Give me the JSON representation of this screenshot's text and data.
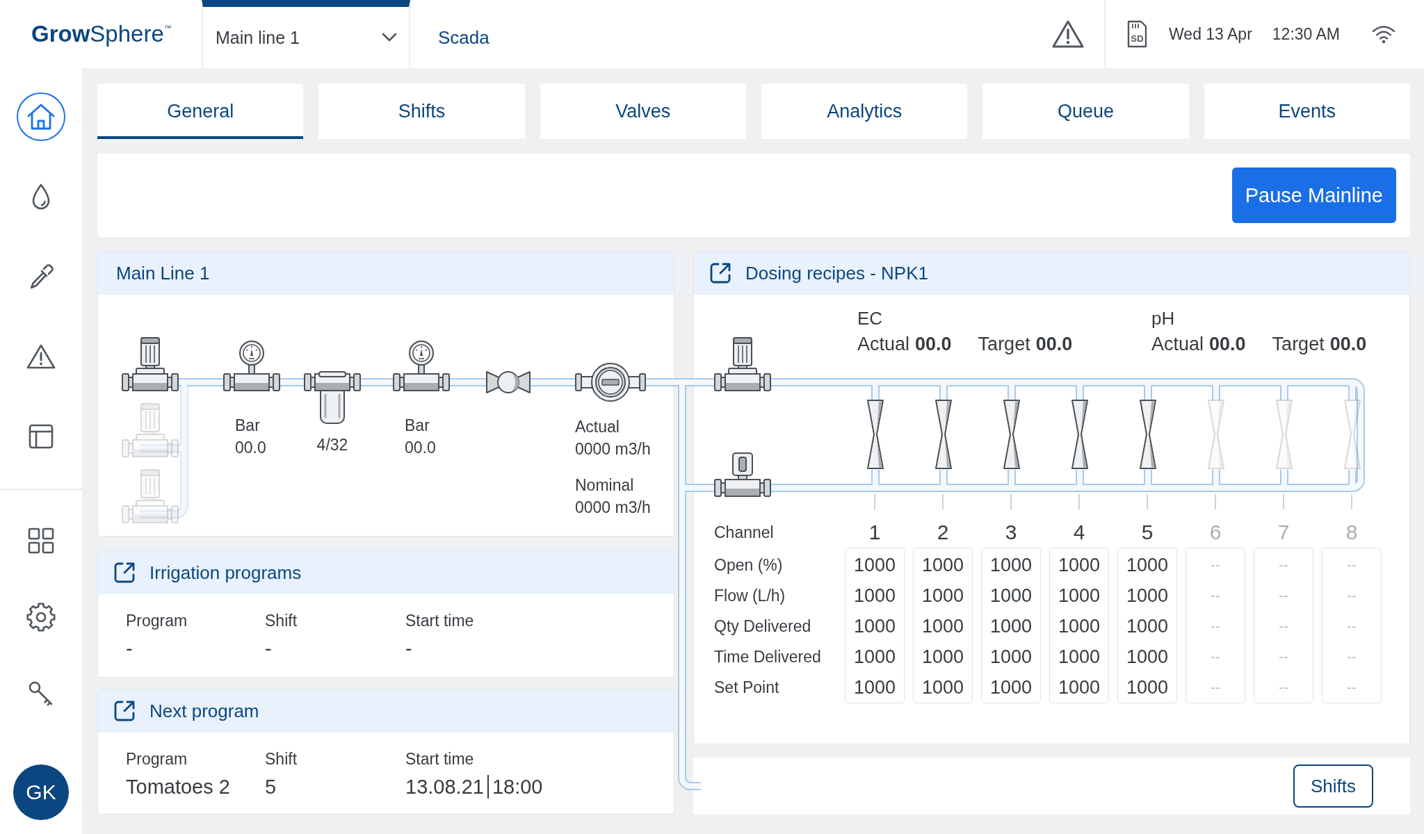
{
  "header": {
    "logo": "**Grow**Sphere$^{™}$",
    "nav": [
      {
        "kind": "dropdown",
        "label": "Main line 1",
        "selected": true
      },
      {
        "kind": "link",
        "label": "Scada",
        "selected": false
      }
    ],
    "storage_label": "SD",
    "date": "Wed 13 Apr",
    "time": "12:30 AM"
  },
  "sidebar": {
    "top_items": [
      {
        "selected": true
      },
      {
        "selected": false
      },
      {
        "selected": false
      },
      {
        "selected": false
      },
      {
        "selected": false
      }
    ],
    "bottom_items": [
      {
        "selected": false
      },
      {
        "selected": false
      },
      {
        "selected": false
      }
    ],
    "avatar": "GK"
  },
  "tabs": [
    {
      "label": "General",
      "selected": true
    },
    {
      "label": "Shifts",
      "selected": false
    },
    {
      "label": "Valves",
      "selected": false
    },
    {
      "label": "Analytics",
      "selected": false
    },
    {
      "label": "Queue",
      "selected": false
    },
    {
      "label": "Events",
      "selected": false
    }
  ],
  "action_bar": {
    "button": "Pause Mainline"
  },
  "main_line": {
    "title": "Main Line 1",
    "equipment": [
      {
        "kind": "pump",
        "active": true
      },
      {
        "kind": "pump",
        "active": false
      },
      {
        "kind": "pump",
        "active": false
      },
      {
        "kind": "gauge",
        "label": "Bar",
        "value": "00.0"
      },
      {
        "kind": "filter",
        "value": "4/32"
      },
      {
        "kind": "gauge",
        "label": "Bar",
        "value": "00.0"
      },
      {
        "kind": "valve"
      },
      {
        "kind": "flow_meter",
        "readings": [
          {
            "label": "Actual",
            "value": "0000 m3/h"
          },
          {
            "label": "Nominal",
            "value": "0000 m3/h"
          }
        ]
      }
    ]
  },
  "irrigation_programs": {
    "title": "Irrigation programs",
    "openable": true,
    "fields": [
      {
        "label": "Program",
        "value": "-"
      },
      {
        "label": "Shift",
        "value": "-"
      },
      {
        "label": "Start time",
        "value": "-"
      }
    ]
  },
  "next_program": {
    "title": "Next program",
    "openable": true,
    "fields": [
      {
        "label": "Program",
        "value": "Tomatoes 2"
      },
      {
        "label": "Shift",
        "value": "5"
      },
      {
        "label": "Start time",
        "value": "13.08.21",
        "time": "18:00"
      }
    ]
  },
  "dosing": {
    "title": "Dosing recipes - NPK1",
    "openable": true,
    "readings": [
      {
        "name": "EC",
        "values": [
          {
            "label": "Actual",
            "value": "00.0"
          },
          {
            "label": "Target",
            "value": "00.0"
          }
        ]
      },
      {
        "name": "pH",
        "values": [
          {
            "label": "Actual",
            "value": "00.0"
          },
          {
            "label": "Target",
            "value": "00.0"
          }
        ]
      }
    ],
    "channel_label": "Channel",
    "row_labels": [
      "Open (%)",
      "Flow (L/h)",
      "Qty Delivered",
      "Time Delivered",
      "Set Point"
    ],
    "channels": [
      {
        "number": "1",
        "enabled": true,
        "values": [
          "1000",
          "1000",
          "1000",
          "1000",
          "1000"
        ]
      },
      {
        "number": "2",
        "enabled": true,
        "values": [
          "1000",
          "1000",
          "1000",
          "1000",
          "1000"
        ]
      },
      {
        "number": "3",
        "enabled": true,
        "values": [
          "1000",
          "1000",
          "1000",
          "1000",
          "1000"
        ]
      },
      {
        "number": "4",
        "enabled": true,
        "values": [
          "1000",
          "1000",
          "1000",
          "1000",
          "1000"
        ]
      },
      {
        "number": "5",
        "enabled": true,
        "values": [
          "1000",
          "1000",
          "1000",
          "1000",
          "1000"
        ]
      },
      {
        "number": "6",
        "enabled": false,
        "values": [
          "--",
          "--",
          "--",
          "--",
          "--"
        ]
      },
      {
        "number": "7",
        "enabled": false,
        "values": [
          "--",
          "--",
          "--",
          "--",
          "--"
        ]
      },
      {
        "number": "8",
        "enabled": false,
        "values": [
          "--",
          "--",
          "--",
          "--",
          "--"
        ]
      }
    ]
  },
  "footer": {
    "button": "Shifts"
  }
}
